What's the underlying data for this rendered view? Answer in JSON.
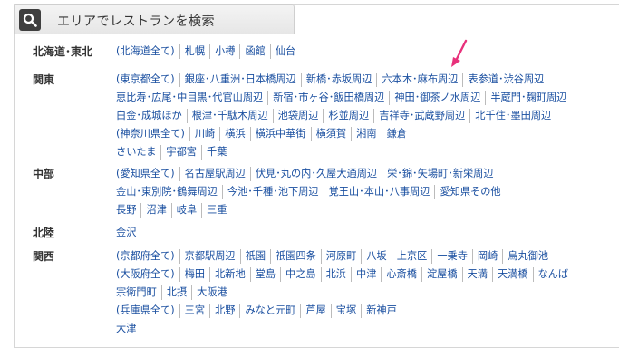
{
  "header": {
    "title": "エリアでレストランを検索",
    "icon": "search-icon"
  },
  "accent_color": "#e8317b",
  "regions": [
    {
      "name": "北海道･東北",
      "lines": [
        [
          "(北海道全て)",
          "札幌",
          "小樽",
          "函館",
          "仙台"
        ]
      ]
    },
    {
      "name": "関東",
      "lines": [
        [
          "(東京都全て)",
          "銀座･八重洲･日本橋周辺",
          "新橋･赤坂周辺",
          "六本木･麻布周辺",
          "表参道･渋谷周辺"
        ],
        [
          "恵比寿･広尾･中目黒･代官山周辺",
          "新宿･市ヶ谷･飯田橋周辺",
          "神田･御茶ノ水周辺",
          "半蔵門･麹町周辺"
        ],
        [
          "白金･成城ほか",
          "根津･千駄木周辺",
          "池袋周辺",
          "杉並周辺",
          "吉祥寺･武蔵野周辺",
          "北千住･墨田周辺"
        ],
        [
          "(神奈川県全て)",
          "川崎",
          "横浜",
          "横浜中華街",
          "横須賀",
          "湘南",
          "鎌倉"
        ],
        [
          "さいたま",
          "宇都宮",
          "千葉"
        ]
      ]
    },
    {
      "name": "中部",
      "lines": [
        [
          "(愛知県全て)",
          "名古屋駅周辺",
          "伏見･丸の内･久屋大通周辺",
          "栄･錦･矢場町･新栄周辺"
        ],
        [
          "金山･東別院･鶴舞周辺",
          "今池･千種･池下周辺",
          "覚王山･本山･八事周辺",
          "愛知県その他"
        ],
        [
          "長野",
          "沼津",
          "岐阜",
          "三重"
        ]
      ]
    },
    {
      "name": "北陸",
      "lines": [
        [
          "金沢"
        ]
      ]
    },
    {
      "name": "関西",
      "lines": [
        [
          "(京都府全て)",
          "京都駅周辺",
          "祇園",
          "祇園四条",
          "河原町",
          "八坂",
          "上京区",
          "一乗寺",
          "岡崎",
          "烏丸御池"
        ],
        [
          "(大阪府全て)",
          "梅田",
          "北新地",
          "堂島",
          "中之島",
          "北浜",
          "中津",
          "心斎橋",
          "淀屋橋",
          "天満",
          "天満橋",
          "なんば"
        ],
        [
          "宗衛門町",
          "北摂",
          "大阪港"
        ],
        [
          "(兵庫県全て)",
          "三宮",
          "北野",
          "みなと元町",
          "芦屋",
          "宝塚",
          "新神戸"
        ],
        [
          "大津"
        ]
      ]
    }
  ]
}
